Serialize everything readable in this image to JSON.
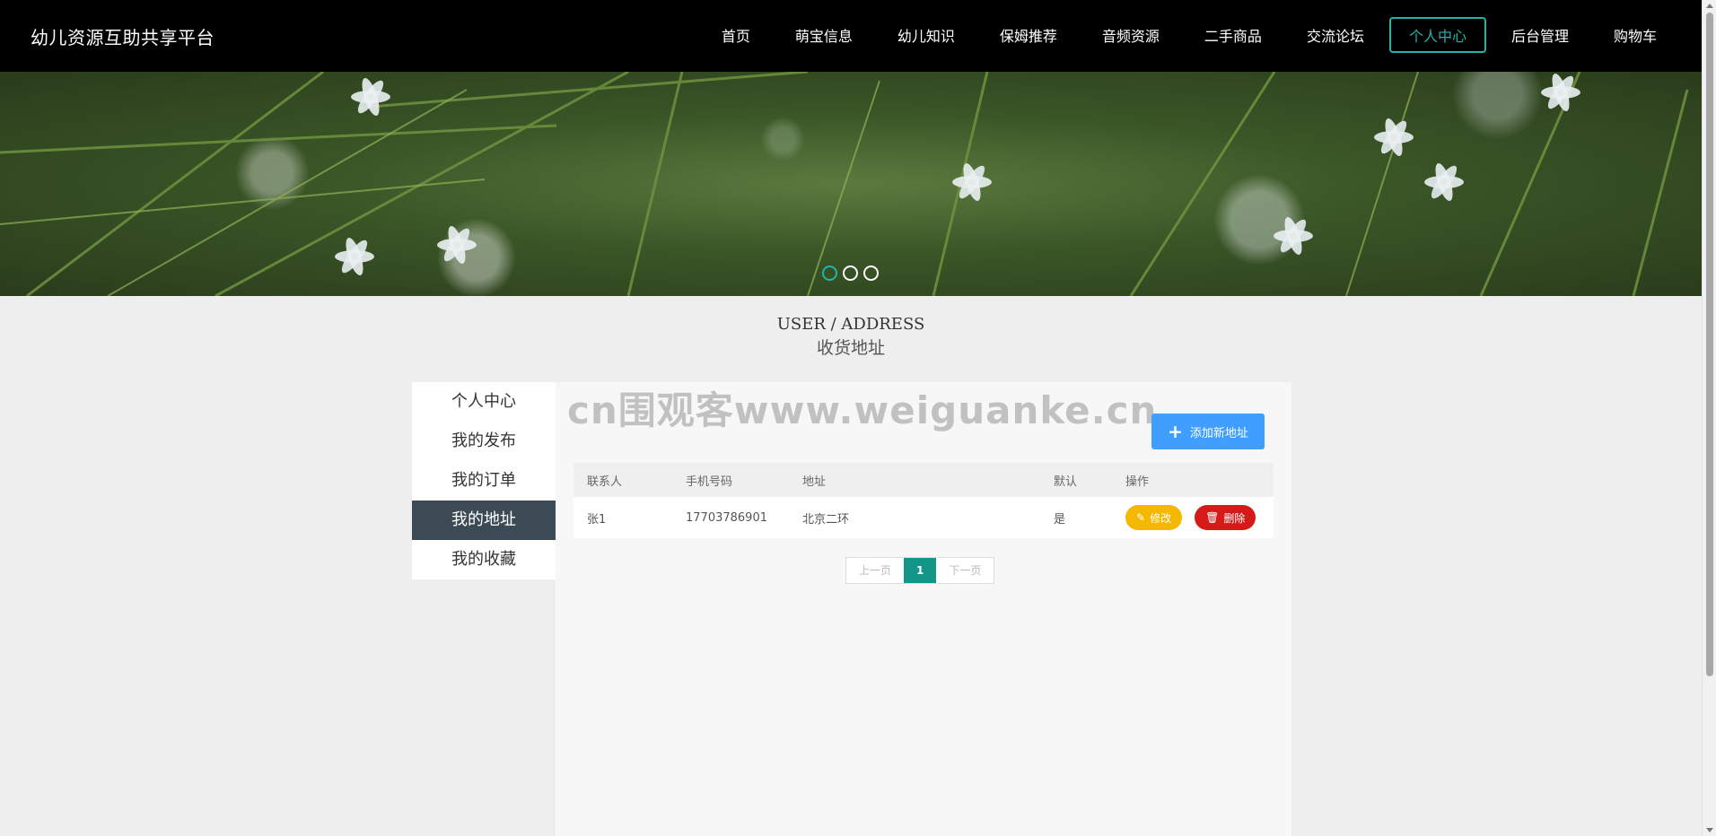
{
  "header": {
    "brand": "幼儿资源互助共享平台",
    "nav": [
      "首页",
      "萌宝信息",
      "幼儿知识",
      "保姆推荐",
      "音频资源",
      "二手商品",
      "交流论坛",
      "个人中心",
      "后台管理",
      "购物车"
    ],
    "active_nav": "个人中心"
  },
  "banner": {
    "slides": 3,
    "active_slide": 1
  },
  "section": {
    "title_en": "USER / ADDRESS",
    "title_cn": "收货地址"
  },
  "sidebar": {
    "items": [
      "个人中心",
      "我的发布",
      "我的订单",
      "我的地址",
      "我的收藏"
    ],
    "active": "我的地址"
  },
  "watermark": "cn围观客www.weiguanke.cn",
  "content": {
    "add_button": "添加新地址",
    "table": {
      "headers": [
        "联系人",
        "手机号码",
        "地址",
        "默认",
        "操作"
      ],
      "rows": [
        {
          "contact": "张1",
          "phone": "17703786901",
          "address": "北京二环",
          "default": "是",
          "edit": "修改",
          "delete": "删除"
        }
      ]
    },
    "pager": {
      "prev": "上一页",
      "current": "1",
      "next": "下一页"
    }
  },
  "colors": {
    "accent": "#1fb5a8",
    "sidebar_active": "#3c4a55",
    "add_button": "#409eff",
    "edit": "#f5b800",
    "delete": "#d61a1a",
    "page_current": "#139688"
  }
}
